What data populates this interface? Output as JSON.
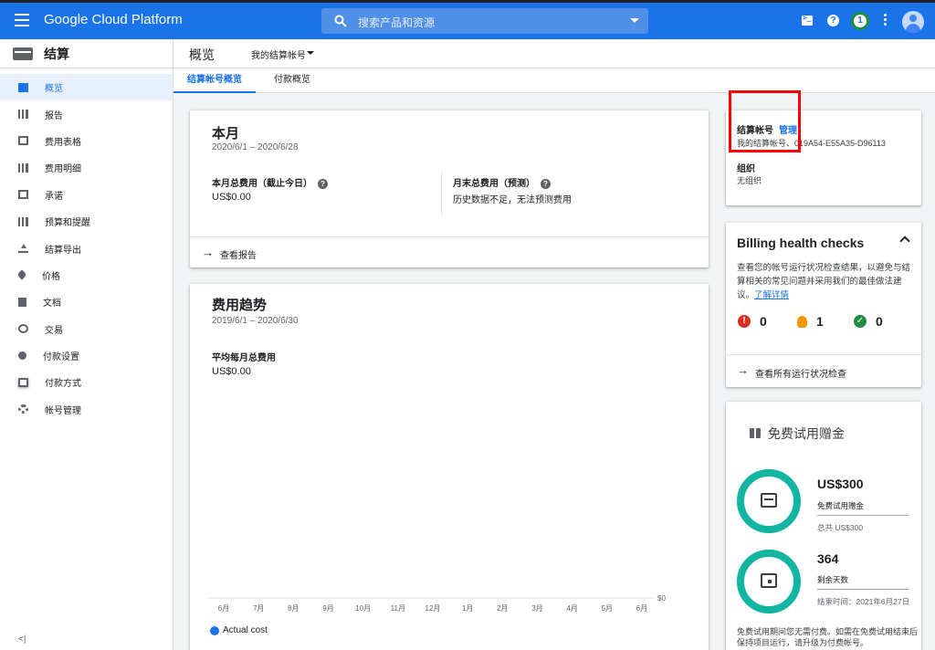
{
  "topbar": {
    "brand": "Google Cloud Platform",
    "search_placeholder": "搜索产品和资源",
    "notification_count": "1",
    "color": "#1a73e8"
  },
  "sidebar": {
    "title": "结算",
    "items": [
      {
        "label": "概览",
        "icon": "dashboard-icon",
        "active": true
      },
      {
        "label": "报告",
        "icon": "bar-chart-icon"
      },
      {
        "label": "费用表格",
        "icon": "table-icon"
      },
      {
        "label": "费用明细",
        "icon": "breakdown-icon"
      },
      {
        "label": "承诺",
        "icon": "percent-icon"
      },
      {
        "label": "预算和提醒",
        "icon": "budget-icon"
      },
      {
        "label": "结算导出",
        "icon": "export-icon"
      },
      {
        "label": "价格",
        "icon": "tag-icon"
      },
      {
        "label": "文档",
        "icon": "document-icon"
      },
      {
        "label": "交易",
        "icon": "clock-icon"
      },
      {
        "label": "付款设置",
        "icon": "person-icon"
      },
      {
        "label": "付款方式",
        "icon": "credit-card-icon"
      },
      {
        "label": "帐号管理",
        "icon": "gear-icon"
      }
    ],
    "collapse_label": "<|"
  },
  "header": {
    "title": "概览",
    "account_selector": "我的结算帐号"
  },
  "tabs": [
    "结算帐号概览",
    "付款概览"
  ],
  "month_card": {
    "title": "本月",
    "range": "2020/6/1 – 2020/6/28",
    "current_label": "本月总费用（截止今日）",
    "current_value": "US$0.00",
    "forecast_label": "月末总费用（预测）",
    "forecast_value": "历史数据不足，无法预测费用",
    "footer": "查看报告"
  },
  "trend_card": {
    "title": "费用趋势",
    "range": "2019/6/1 – 2020/6/30",
    "avg_label": "平均每月总费用",
    "avg_value": "US$0.00"
  },
  "chart_data": {
    "type": "bar",
    "categories": [
      "6月",
      "7月",
      "8月",
      "9月",
      "10月",
      "11月",
      "12月",
      "1月",
      "2月",
      "3月",
      "4月",
      "5月",
      "6月"
    ],
    "series": [
      {
        "name": "Actual cost",
        "values": [
          0,
          0,
          0,
          0,
          0,
          0,
          0,
          0,
          0,
          0,
          0,
          0,
          0
        ]
      }
    ],
    "y_tick_label": "$0",
    "color": "#1a73e8"
  },
  "account_card": {
    "label": "结算帐号",
    "manage": "管理",
    "account_id": "我的结算帐号、019A54-E55A35-D96113",
    "org_label": "组织",
    "org_value": "无组织"
  },
  "health_card": {
    "title": "Billing health checks",
    "desc": "查看您的帐号运行状况检查结果，以避免与结算相关的常见问题并采用我们的最佳做法建议。",
    "link": "了解详情",
    "red_count": "0",
    "orange_count": "1",
    "green_count": "0",
    "footer": "查看所有运行状况检查"
  },
  "trial_card": {
    "title": "免费试用赠金",
    "credit_value": "US$300",
    "credit_label": "免费试用赠金",
    "credit_total": "总共 US$300",
    "credit_remaining_fraction": 1.0,
    "days_value": "364",
    "days_label": "剩余天数",
    "end_date": "结束时间：2021年6月27日",
    "note": "免费试用期间您无需付费。如需在免费试用结束后保持项目运行，请升级为付费帐号。"
  }
}
